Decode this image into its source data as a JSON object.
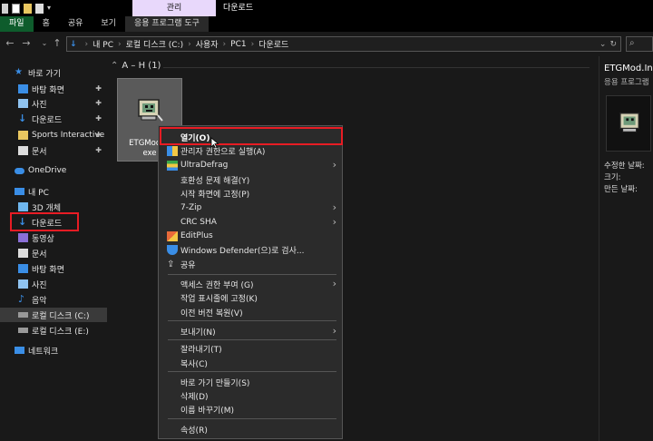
{
  "ribbon": {
    "tool_tab": "관리",
    "window_title": "다운로드",
    "tabs": [
      "파일",
      "홈",
      "공유",
      "보기",
      "응용 프로그램 도구"
    ]
  },
  "address": {
    "path": [
      "내 PC",
      "로컬 디스크 (C:)",
      "사용자",
      "PC1",
      "다운로드"
    ]
  },
  "sidebar": {
    "items": [
      {
        "label": "바로 가기",
        "pinned": false
      },
      {
        "label": "바탕 화면",
        "pinned": true
      },
      {
        "label": "사진",
        "pinned": true
      },
      {
        "label": "다운로드",
        "pinned": true
      },
      {
        "label": "Sports Interactive",
        "pinned": true
      },
      {
        "label": "문서",
        "pinned": true
      },
      {
        "label": "OneDrive",
        "pinned": false
      },
      {
        "label": "내 PC",
        "pinned": false
      },
      {
        "label": "3D 개체",
        "pinned": false
      },
      {
        "label": "다운로드",
        "pinned": false
      },
      {
        "label": "동영상",
        "pinned": false
      },
      {
        "label": "문서",
        "pinned": false
      },
      {
        "label": "바탕 화면",
        "pinned": false
      },
      {
        "label": "사진",
        "pinned": false
      },
      {
        "label": "음악",
        "pinned": false
      },
      {
        "label": "로컬 디스크 (C:)",
        "pinned": false
      },
      {
        "label": "로컬 디스크 (E:)",
        "pinned": false
      },
      {
        "label": "네트워크",
        "pinned": false
      }
    ]
  },
  "content": {
    "group_header": "A – H (1)",
    "file_name": "ETGMod.Installer.exe",
    "file_label_line1": "ETGMod.In",
    "file_label_line2": "exe"
  },
  "details": {
    "title": "ETGMod.In",
    "type": "응용 프로그램",
    "modified": "수정한 날짜:",
    "size": "크기:",
    "created": "만든 날짜:"
  },
  "context_menu": {
    "items": [
      {
        "label": "열기(O)",
        "bold": true
      },
      {
        "label": "관리자 권한으로 실행(A)"
      },
      {
        "label": "UltraDefrag",
        "submenu": true
      },
      {
        "label": "호환성 문제 해결(Y)"
      },
      {
        "label": "시작 화면에 고정(P)"
      },
      {
        "label": "7-Zip",
        "submenu": true
      },
      {
        "label": "CRC SHA",
        "submenu": true
      },
      {
        "label": "EditPlus"
      },
      {
        "label": "Windows Defender(으)로 검사..."
      },
      {
        "label": "공유"
      },
      {
        "label": "액세스 권한 부여 (G)",
        "submenu": true
      },
      {
        "label": "작업 표시줄에 고정(K)"
      },
      {
        "label": "이전 버전 복원(V)"
      },
      {
        "label": "보내기(N)",
        "submenu": true
      },
      {
        "label": "잘라내기(T)"
      },
      {
        "label": "복사(C)"
      },
      {
        "label": "바로 가기 만들기(S)"
      },
      {
        "label": "삭제(D)"
      },
      {
        "label": "이름 바꾸기(M)"
      },
      {
        "label": "속성(R)"
      }
    ]
  },
  "colors": {
    "selection_tab": "#0e5c2c",
    "tool_tab": "#e8d8fb",
    "highlight_box": "#e81c24",
    "accent_blue": "#3a8ee6"
  }
}
